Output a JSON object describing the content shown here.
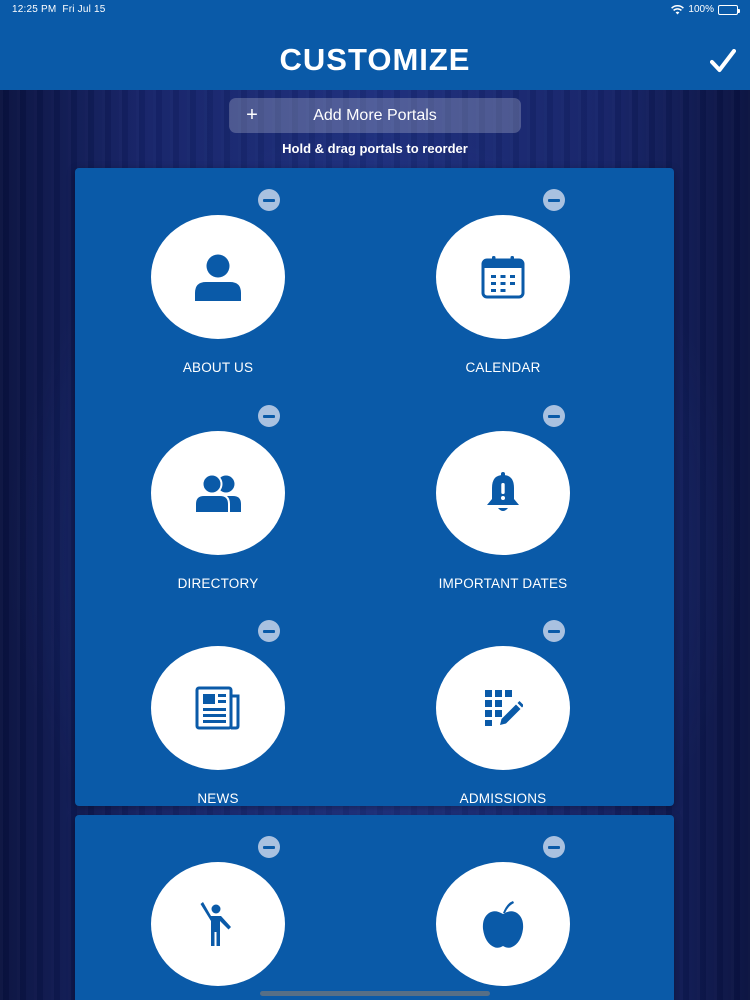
{
  "status_bar": {
    "time": "12:25 PM",
    "date": "Fri Jul 15",
    "battery": "100%"
  },
  "header": {
    "title": "CUSTOMIZE"
  },
  "add_portals": {
    "plus": "+",
    "label": "Add More Portals"
  },
  "hint": "Hold & drag portals to reorder",
  "portals": [
    {
      "label": "ABOUT US",
      "icon": "person-icon"
    },
    {
      "label": "CALENDAR",
      "icon": "calendar-icon"
    },
    {
      "label": "DIRECTORY",
      "icon": "people-icon"
    },
    {
      "label": "IMPORTANT DATES",
      "icon": "bell-alert-icon"
    },
    {
      "label": "NEWS",
      "icon": "newspaper-icon"
    },
    {
      "label": "ADMISSIONS",
      "icon": "grid-edit-icon"
    },
    {
      "label": "",
      "icon": "raised-hand-person-icon"
    },
    {
      "label": "",
      "icon": "apple-icon"
    }
  ],
  "colors": {
    "header_bg": "#0a5aa8",
    "panel_bg": "#0a5aa8",
    "icon": "#0a5aa8",
    "remove_badge": "#a9c1e0"
  }
}
